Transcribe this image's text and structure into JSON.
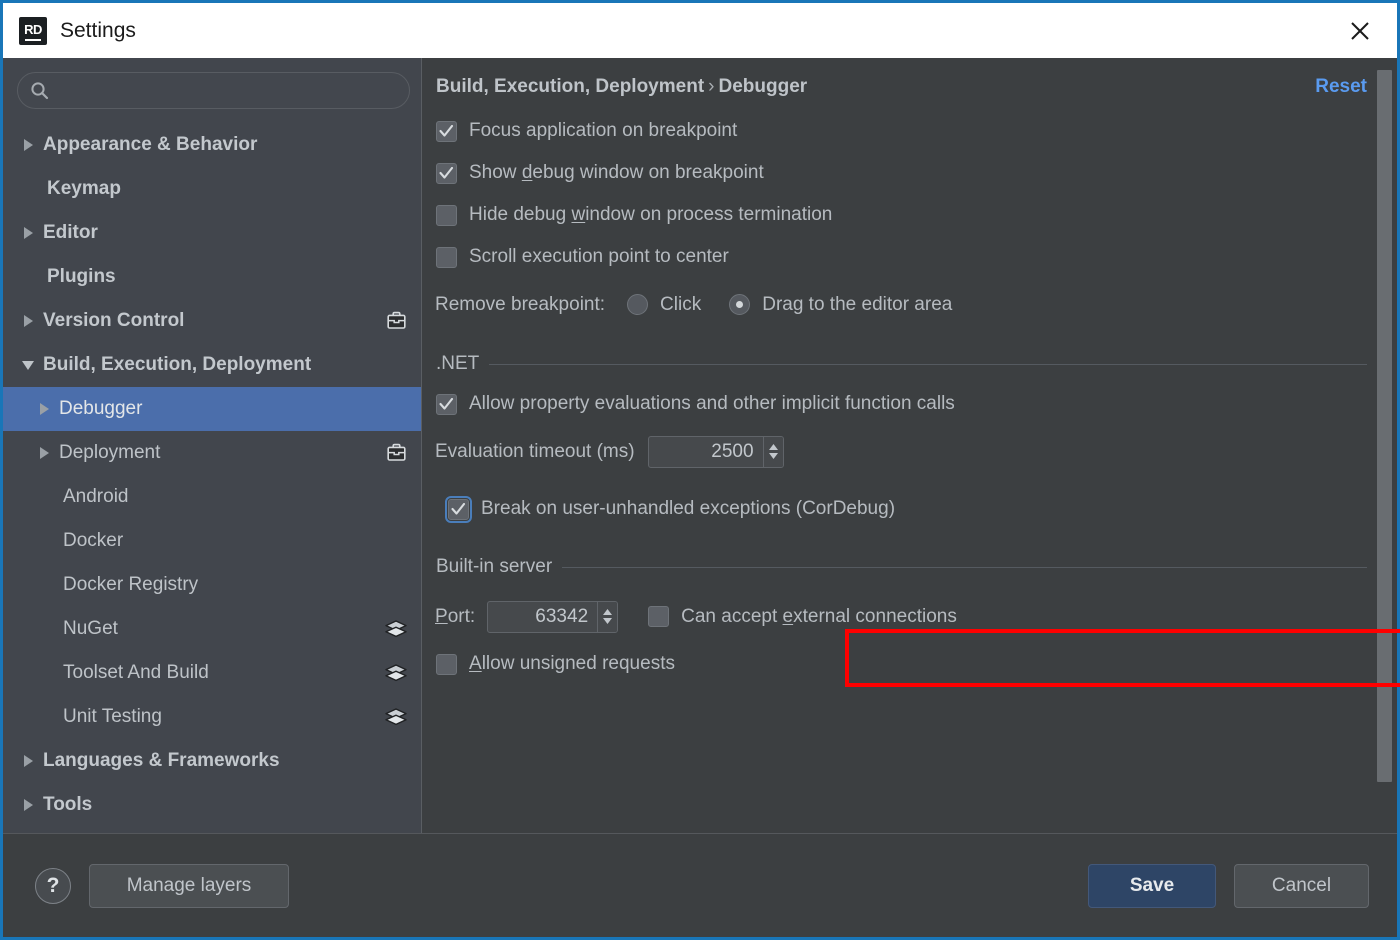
{
  "window": {
    "title": "Settings",
    "logo_text": "RD",
    "close_icon": "close-icon"
  },
  "sidebar": {
    "search": {
      "value": "",
      "placeholder": ""
    },
    "items": [
      {
        "label": "Appearance & Behavior",
        "level": 0,
        "arrow": "collapsed",
        "icon": null,
        "selected": false
      },
      {
        "label": "Keymap",
        "level": 0,
        "arrow": null,
        "icon": null,
        "selected": false
      },
      {
        "label": "Editor",
        "level": 0,
        "arrow": "collapsed",
        "icon": null,
        "selected": false
      },
      {
        "label": "Plugins",
        "level": 0,
        "arrow": null,
        "icon": null,
        "selected": false
      },
      {
        "label": "Version Control",
        "level": 0,
        "arrow": "collapsed",
        "icon": "briefcase-icon",
        "selected": false
      },
      {
        "label": "Build, Execution, Deployment",
        "level": 0,
        "arrow": "expanded",
        "icon": null,
        "selected": false
      },
      {
        "label": "Debugger",
        "level": 1,
        "arrow": "collapsed",
        "icon": null,
        "selected": true
      },
      {
        "label": "Deployment",
        "level": 1,
        "arrow": "collapsed",
        "icon": "briefcase-icon",
        "selected": false
      },
      {
        "label": "Android",
        "level": 1,
        "arrow": null,
        "icon": null,
        "selected": false
      },
      {
        "label": "Docker",
        "level": 1,
        "arrow": null,
        "icon": null,
        "selected": false
      },
      {
        "label": "Docker Registry",
        "level": 1,
        "arrow": null,
        "icon": null,
        "selected": false
      },
      {
        "label": "NuGet",
        "level": 1,
        "arrow": null,
        "icon": "layers-icon",
        "selected": false
      },
      {
        "label": "Toolset And Build",
        "level": 1,
        "arrow": null,
        "icon": "layers-icon",
        "selected": false
      },
      {
        "label": "Unit Testing",
        "level": 1,
        "arrow": null,
        "icon": "layers-icon",
        "selected": false
      },
      {
        "label": "Languages & Frameworks",
        "level": 0,
        "arrow": "collapsed",
        "icon": null,
        "selected": false
      },
      {
        "label": "Tools",
        "level": 0,
        "arrow": "collapsed",
        "icon": null,
        "selected": false
      }
    ]
  },
  "main": {
    "breadcrumb_root": "Build, Execution, Deployment",
    "breadcrumb_sep": "›",
    "breadcrumb_leaf": "Debugger",
    "reset_label": "Reset",
    "checkbox_focus_on_breakpoint": {
      "label": "Focus application on breakpoint",
      "checked": true
    },
    "checkbox_show_debug_window": {
      "label_pre": "Show ",
      "label_mnemonic": "d",
      "label_post": "ebug window on breakpoint",
      "checked": true
    },
    "checkbox_hide_debug_window": {
      "label_pre": "Hide debug ",
      "label_mnemonic": "w",
      "label_post": "indow on process termination",
      "checked": false
    },
    "checkbox_scroll_execution": {
      "label": "Scroll execution point to center",
      "checked": false
    },
    "remove_breakpoint": {
      "label": "Remove breakpoint:",
      "options": [
        {
          "label": "Click",
          "selected": false
        },
        {
          "label": "Drag to the editor area",
          "selected": true
        }
      ]
    },
    "section_dotnet": {
      "title": ".NET"
    },
    "checkbox_allow_property_eval": {
      "label": "Allow property evaluations and other implicit function calls",
      "checked": true
    },
    "evaluation_timeout": {
      "label": "Evaluation timeout (ms)",
      "value": "2500"
    },
    "checkbox_break_unhandled": {
      "label": "Break on user-unhandled exceptions (CorDebug)",
      "checked": true,
      "focused": true,
      "highlight_color": "#fe0000"
    },
    "section_builtin_server": {
      "title": "Built-in server"
    },
    "port": {
      "label_mnemonic": "P",
      "label_post": "ort:",
      "value": "63342"
    },
    "checkbox_external_connections": {
      "label_pre": "Can accept ",
      "label_mnemonic": "e",
      "label_post": "xternal connections",
      "checked": false
    },
    "checkbox_unsigned_requests": {
      "label_pre": "",
      "label_mnemonic": "A",
      "label_post": "llow unsigned requests",
      "checked": false
    }
  },
  "footer": {
    "help_label": "?",
    "manage_layers_label": "Manage layers",
    "save_label": "Save",
    "cancel_label": "Cancel"
  },
  "colors": {
    "accent_selection": "#4b6eab",
    "link": "#5a9bf0",
    "highlight": "#fe0000",
    "window_border": "#1976b8",
    "save_button": "#2e4566"
  }
}
